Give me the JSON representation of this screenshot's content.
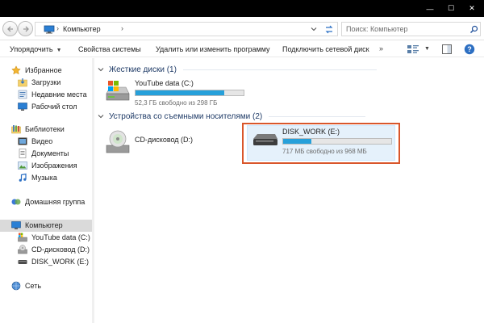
{
  "window": {
    "controls": {
      "minimize": "—",
      "maximize": "☐",
      "close": "✕"
    }
  },
  "address": {
    "current": "Компьютер",
    "separator": "›"
  },
  "search": {
    "placeholder": "Поиск: Компьютер"
  },
  "commands": {
    "organize": "Упорядочить",
    "system_props": "Свойства системы",
    "uninstall": "Удалить или изменить программу",
    "map_drive": "Подключить сетевой диск",
    "more": "»"
  },
  "nav": {
    "favorites": "Избранное",
    "downloads": "Загрузки",
    "recent": "Недавние места",
    "desktop": "Рабочий стол",
    "libraries": "Библиотеки",
    "video": "Видео",
    "documents": "Документы",
    "images": "Изображения",
    "music": "Музыка",
    "homegroup": "Домашняя группа",
    "computer": "Компьютер",
    "drive_c": "YouTube data (C:)",
    "drive_d": "CD-дисковод (D:)",
    "drive_e": "DISK_WORK (E:)",
    "network": "Сеть"
  },
  "groups": {
    "hard_disks": "Жесткие диски (1)",
    "removable": "Устройства со съемными носителями (2)"
  },
  "drives": {
    "c": {
      "name": "YouTube data (C:)",
      "info": "52,3 ГБ свободно из 298 ГБ",
      "used_fraction": 0.82
    },
    "d": {
      "name": "CD-дисковод (D:)"
    },
    "e": {
      "name": "DISK_WORK (E:)",
      "info": "717 МБ свободно из 968 МБ",
      "used_fraction": 0.26
    }
  },
  "colors": {
    "accent": "#26a0da",
    "highlight": "#d9562b",
    "titlebar": "#000000"
  }
}
